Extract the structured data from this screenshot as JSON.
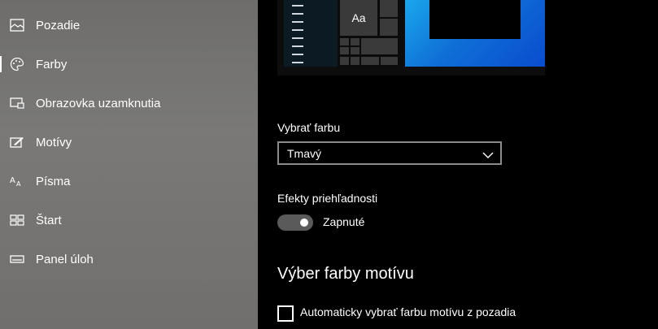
{
  "sidebar": {
    "items": [
      {
        "label": "Pozadie",
        "icon": "picture-icon"
      },
      {
        "label": "Farby",
        "icon": "palette-icon",
        "selected": true
      },
      {
        "label": "Obrazovka uzamknutia",
        "icon": "lock-screen-icon"
      },
      {
        "label": "Motívy",
        "icon": "themes-icon"
      },
      {
        "label": "Písma",
        "icon": "fonts-icon"
      },
      {
        "label": "Štart",
        "icon": "start-icon"
      },
      {
        "label": "Panel úloh",
        "icon": "taskbar-icon"
      }
    ]
  },
  "preview": {
    "sample_text": "Aa"
  },
  "color_choice": {
    "label": "Vybrať farbu",
    "value": "Tmavý"
  },
  "transparency": {
    "label": "Efekty priehľadnosti",
    "state_text": "Zapnuté",
    "on": true
  },
  "accent": {
    "section_title": "Výber farby motívu",
    "auto_checkbox_label": "Automaticky vybrať farbu motívu z pozadia",
    "auto_checked": false
  },
  "colors": {
    "sidebar_bg": "#757472",
    "content_bg": "#000000",
    "accent_blue": "#0f6fd6"
  }
}
